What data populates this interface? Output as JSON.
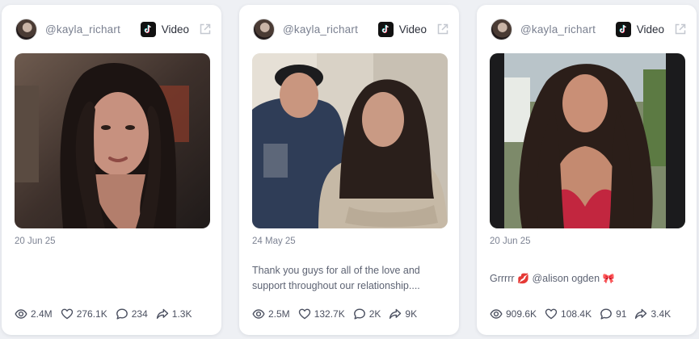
{
  "posts": [
    {
      "handle": "@kayla_richart",
      "platform_icon": "tiktok-icon",
      "type_label": "Video",
      "date": "20 Jun 25",
      "caption": "",
      "stats": {
        "views": "2.4M",
        "likes": "276.1K",
        "comments": "234",
        "shares": "1.3K"
      }
    },
    {
      "handle": "@kayla_richart",
      "platform_icon": "tiktok-icon",
      "type_label": "Video",
      "date": "24 May 25",
      "caption": "Thank you guys for all of the love and support throughout our relationship....",
      "stats": {
        "views": "2.5M",
        "likes": "132.7K",
        "comments": "2K",
        "shares": "9K"
      }
    },
    {
      "handle": "@kayla_richart",
      "platform_icon": "tiktok-icon",
      "type_label": "Video",
      "date": "20 Jun 25",
      "caption_parts": {
        "text1": "Grrrrr ",
        "emoji1": "💋",
        "text2": " @alison ogden ",
        "emoji2": "🎀"
      },
      "stats": {
        "views": "909.6K",
        "likes": "108.4K",
        "comments": "91",
        "shares": "3.4K"
      }
    }
  ],
  "colors": {
    "accent_text": "#2b2f3a",
    "muted_text": "#7d8393",
    "card_bg": "#ffffff",
    "page_bg": "#eef0f4"
  }
}
